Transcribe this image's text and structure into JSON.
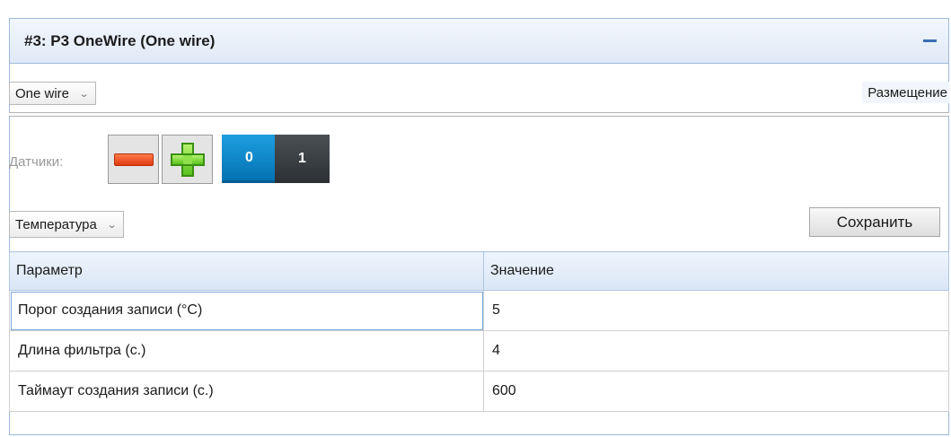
{
  "panel": {
    "title": "#3: P3 OneWire (One wire)"
  },
  "type_dropdown": {
    "value": "One wire"
  },
  "placement_label": "Размещение",
  "sensors": {
    "label": "Датчики:",
    "tabs": [
      {
        "label": "0",
        "active": true
      },
      {
        "label": "1",
        "active": false
      }
    ]
  },
  "measure_dropdown": {
    "value": "Температура"
  },
  "save_label": "Сохранить",
  "table": {
    "headers": [
      "Параметр",
      "Значение"
    ],
    "rows": [
      [
        "Порог создания записи (°C)",
        "5"
      ],
      [
        "Длина фильтра (с.)",
        "4"
      ],
      [
        "Таймаут создания записи (с.)",
        "600"
      ]
    ]
  },
  "colors": {
    "accent": "#0a83c8",
    "header_bg": "#dfe9f6",
    "inactive_tab": "#34393d"
  },
  "icons": [
    "collapse-icon",
    "chevron-down-icon",
    "minus-icon",
    "plus-icon"
  ]
}
